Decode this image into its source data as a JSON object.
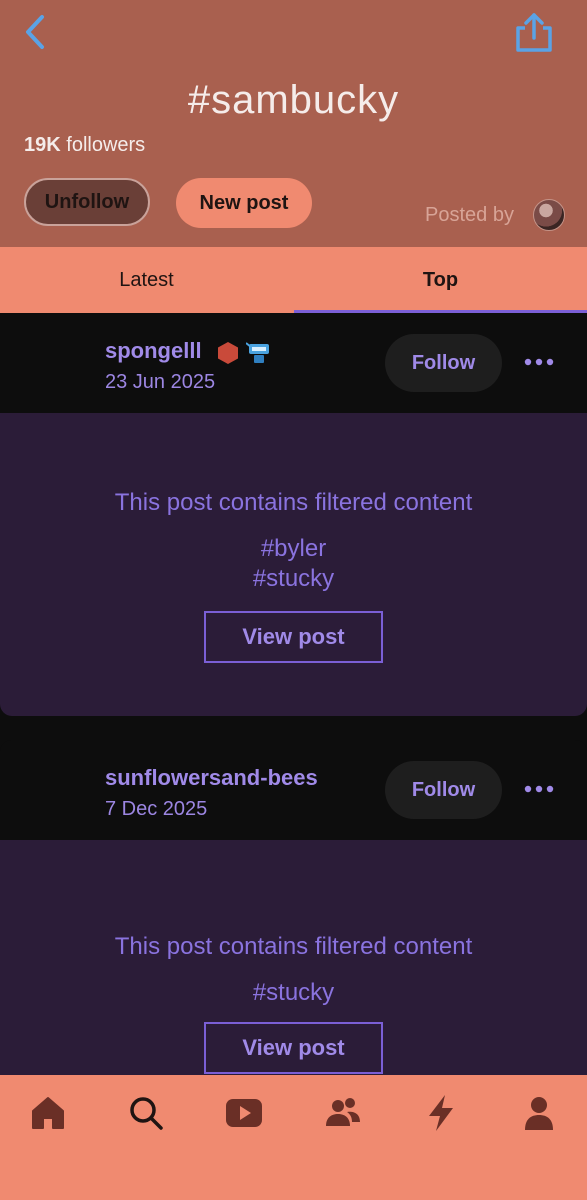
{
  "header": {
    "title": "#sambucky",
    "followers_count": "19K",
    "followers_label": "followers",
    "unfollow_label": "Unfollow",
    "new_post_label": "New post",
    "posted_by_label": "Posted by",
    "back_icon": "chevron-left-icon",
    "share_icon": "share-icon"
  },
  "tabs": [
    {
      "label": "Latest",
      "active": false
    },
    {
      "label": "Top",
      "active": true
    }
  ],
  "posts": [
    {
      "username": "spongelll",
      "date": "23 Jun 2025",
      "follow_label": "Follow",
      "filter_message": "This post contains filtered content",
      "tags": [
        "#byler",
        "#stucky"
      ],
      "view_label": "View post"
    },
    {
      "username": "sunflowersand-bees",
      "date": "7 Dec 2025",
      "follow_label": "Follow",
      "filter_message": "This post contains filtered content",
      "tags": [
        "#stucky"
      ],
      "view_label": "View post"
    }
  ],
  "bottom_nav": [
    "home-icon",
    "search-icon",
    "video-icon",
    "people-icon",
    "bolt-icon",
    "profile-icon"
  ],
  "colors": {
    "header_bg": "#a9604f",
    "tab_bg": "#f08a70",
    "accent_purple": "#a08ae8",
    "card_body_bg": "#2b1c38",
    "card_head_bg": "#0d0d0d"
  }
}
